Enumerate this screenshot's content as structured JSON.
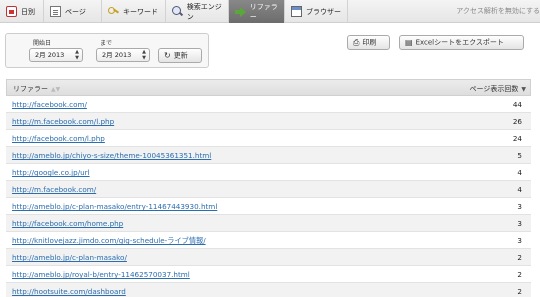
{
  "tabs": [
    {
      "label": "日別",
      "icon": "calendar-icon",
      "active": false
    },
    {
      "label": "ページ",
      "icon": "page-icon",
      "active": false
    },
    {
      "label": "キーワード",
      "icon": "key-icon",
      "active": false
    },
    {
      "label": "検索エンジン",
      "icon": "magnifier-icon",
      "active": false
    },
    {
      "label": "リファラー",
      "icon": "arrow-right-icon",
      "active": true
    },
    {
      "label": "ブラウザー",
      "icon": "browser-window-icon",
      "active": false
    }
  ],
  "notice": "アクセス解析を無効にする",
  "filter": {
    "start_label": "開始日",
    "end_label": "まで",
    "start_value": "2月 2013",
    "end_value": "2月 2013",
    "update_label": "更新"
  },
  "actions": {
    "print_label": "印刷",
    "export_label": "Excelシートをエクスポート"
  },
  "table": {
    "col_referrer": "リファラー",
    "col_count": "ページ表示回数",
    "rows": [
      {
        "url": "http://facebook.com/",
        "count": "44"
      },
      {
        "url": "http://m.facebook.com/l.php",
        "count": "26"
      },
      {
        "url": "http://facebook.com/l.php",
        "count": "24"
      },
      {
        "url": "http://ameblo.jp/chiyo-s-size/theme-10045361351.html",
        "count": "5"
      },
      {
        "url": "http://google.co.jp/url",
        "count": "4"
      },
      {
        "url": "http://m.facebook.com/",
        "count": "4"
      },
      {
        "url": "http://ameblo.jp/c-plan-masako/entry-11467443930.html",
        "count": "3"
      },
      {
        "url": "http://facebook.com/home.php",
        "count": "3"
      },
      {
        "url": "http://knitlovejazz.jimdo.com/gig-schedule-ライブ情報/",
        "count": "3"
      },
      {
        "url": "http://ameblo.jp/c-plan-masako/",
        "count": "2"
      },
      {
        "url": "http://ameblo.jp/royal-b/entry-11462570037.html",
        "count": "2"
      },
      {
        "url": "http://hootsuite.com/dashboard",
        "count": "2"
      }
    ]
  }
}
